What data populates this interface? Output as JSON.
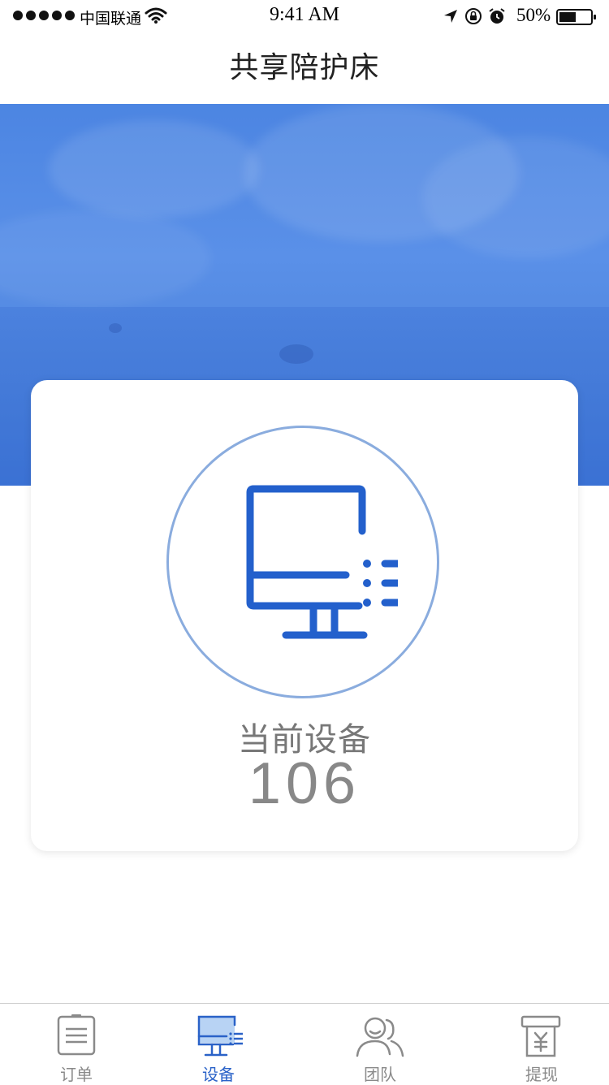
{
  "status_bar": {
    "carrier": "中国联通",
    "time": "9:41 AM",
    "battery": "50%",
    "icons": [
      "signal-dots-icon",
      "wifi-icon",
      "location-arrow-icon",
      "orientation-lock-icon",
      "alarm-icon",
      "battery-icon"
    ]
  },
  "nav": {
    "title": "共享陪护床"
  },
  "card": {
    "icon": "monitor-icon",
    "label": "当前设备",
    "count": "106"
  },
  "tabs": [
    {
      "label": "订单",
      "icon": "order-list-icon",
      "active": false
    },
    {
      "label": "设备",
      "icon": "monitor-icon",
      "active": true
    },
    {
      "label": "团队",
      "icon": "team-icon",
      "active": false
    },
    {
      "label": "提现",
      "icon": "withdraw-icon",
      "active": false
    }
  ],
  "colors": {
    "accent": "#2a62c8",
    "hero_blue": "#4c85e2",
    "icon_blue": "#2360cc",
    "circle_border": "#8aacde",
    "inactive_gray": "#8a8a8a"
  }
}
